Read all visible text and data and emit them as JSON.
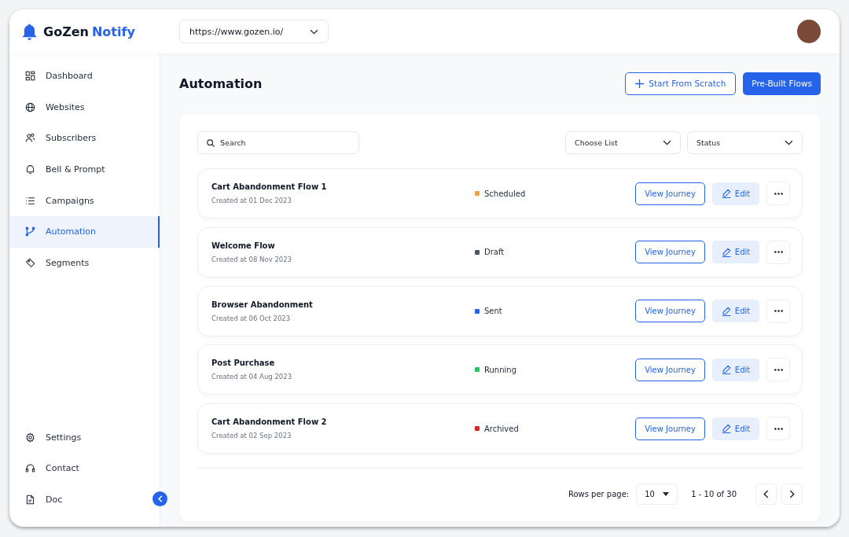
{
  "brand": {
    "name": "GoZen",
    "accent": "Notify"
  },
  "site_select": {
    "value": "https://www.gozen.io/"
  },
  "sidebar": {
    "items": [
      {
        "label": "Dashboard",
        "kind": "dashboard",
        "selected": false
      },
      {
        "label": "Websites",
        "kind": "globe",
        "selected": false
      },
      {
        "label": "Subscribers",
        "kind": "users",
        "selected": false
      },
      {
        "label": "Bell & Prompt",
        "kind": "bell",
        "selected": false
      },
      {
        "label": "Campaigns",
        "kind": "list",
        "selected": false
      },
      {
        "label": "Automation",
        "kind": "flow",
        "selected": true
      },
      {
        "label": "Segments",
        "kind": "tag",
        "selected": false
      }
    ],
    "bottom_items": [
      {
        "label": "Settings",
        "kind": "gear",
        "selected": false
      },
      {
        "label": "Contact",
        "kind": "headset",
        "selected": false
      },
      {
        "label": "Doc",
        "kind": "doc",
        "selected": false
      }
    ]
  },
  "page_title": "Automation",
  "actions": {
    "secondary": "Start From Scratch",
    "primary": "Pre-Built Flows"
  },
  "filters": {
    "search_placeholder": "Search",
    "list_select": "Choose List",
    "status_select": "Status"
  },
  "flows": [
    {
      "name": "Cart Abandonment Flow 1",
      "created": "Created at 01 Dec 2023",
      "status": "Scheduled",
      "color": "#f0a24a",
      "view": "View Journey",
      "edit": "Edit"
    },
    {
      "name": "Welcome Flow",
      "created": "Created at 08 Nov 2023",
      "status": "Draft",
      "color": "#4b5563",
      "view": "View Journey",
      "edit": "Edit"
    },
    {
      "name": "Browser Abandonment",
      "created": "Created at 06 Oct 2023",
      "status": "Sent",
      "color": "#2563eb",
      "view": "View Journey",
      "edit": "Edit"
    },
    {
      "name": "Post Purchase",
      "created": "Created at 04 Aug 2023",
      "status": "Running",
      "color": "#22c55e",
      "view": "View Journey",
      "edit": "Edit"
    },
    {
      "name": "Cart Abandonment Flow 2",
      "created": "Created at 02 Sep 2023",
      "status": "Archived",
      "color": "#dc2626",
      "view": "View Journey",
      "edit": "Edit"
    }
  ],
  "pagination": {
    "rows_label": "Rows per page:",
    "rows_value": "10",
    "range": "1 - 10 of 30"
  }
}
